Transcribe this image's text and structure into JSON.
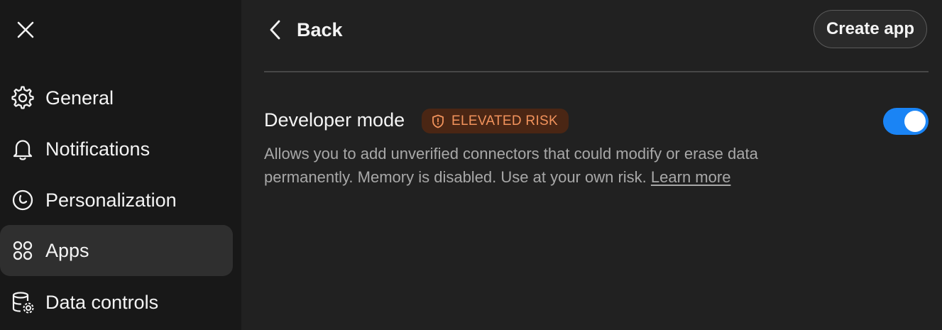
{
  "sidebar": {
    "close_icon": "close-icon",
    "items": [
      {
        "label": "General",
        "icon": "gear-icon"
      },
      {
        "label": "Notifications",
        "icon": "bell-icon"
      },
      {
        "label": "Personalization",
        "icon": "personalization-icon"
      },
      {
        "label": "Apps",
        "icon": "apps-grid-icon",
        "active": true
      },
      {
        "label": "Data controls",
        "icon": "database-gear-icon"
      }
    ]
  },
  "header": {
    "back_label": "Back",
    "create_app_label": "Create app"
  },
  "setting": {
    "title": "Developer mode",
    "badge": "ELEVATED RISK",
    "description": "Allows you to add unverified connectors that could modify or erase data permanently. Memory is disabled. Use at your own risk.",
    "link": "Learn more",
    "enabled": true
  },
  "colors": {
    "background": "#212121",
    "sidebar": "#181818",
    "active_item": "#2f2f2f",
    "toggle_on": "#1a84f5",
    "badge_bg": "#4a2614",
    "badge_text": "#f2935c"
  }
}
